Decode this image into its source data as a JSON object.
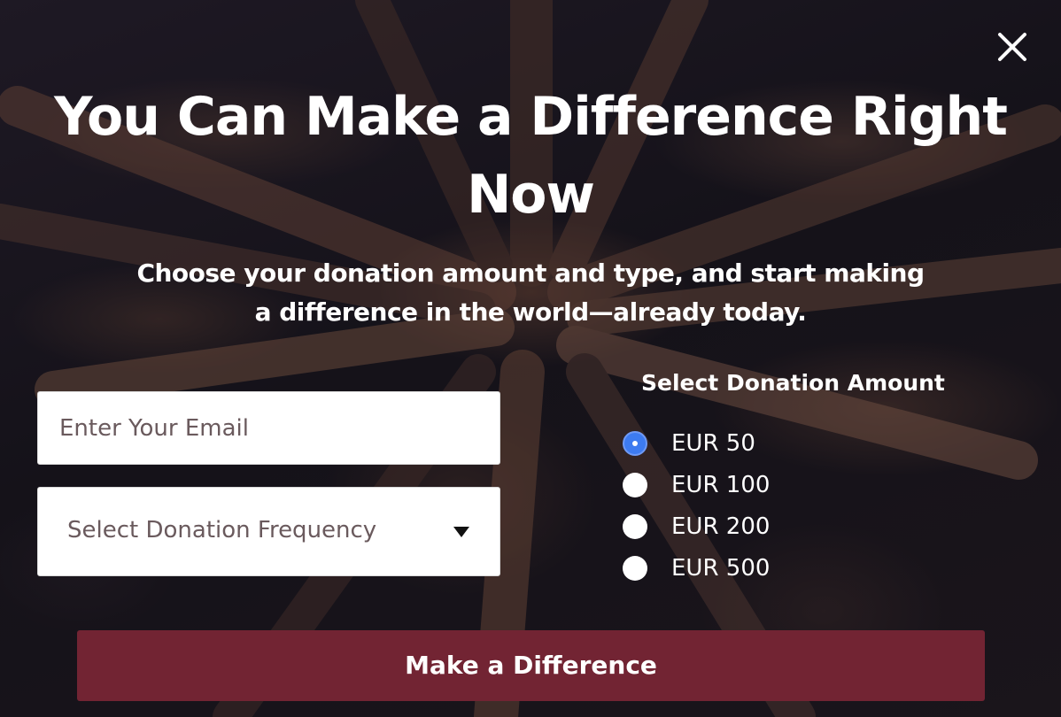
{
  "popup": {
    "close_icon": "close-icon",
    "headline": "You Can Make a Difference Right Now",
    "subhead": "Choose your donation amount and type, and start making a difference in the world—already today."
  },
  "form": {
    "email_placeholder": "Enter Your Email",
    "frequency_select": {
      "selected": "Select Donation Frequency",
      "icon": "caret-down-icon"
    },
    "amount": {
      "title": "Select Donation Amount",
      "options": [
        {
          "label": "EUR 50",
          "selected": true
        },
        {
          "label": "EUR 100",
          "selected": false
        },
        {
          "label": "EUR 200",
          "selected": false
        },
        {
          "label": "EUR 500",
          "selected": false
        }
      ]
    },
    "submit_label": "Make a Difference"
  },
  "colors": {
    "button": "#722433",
    "radio_selected": "#3d7bf0",
    "text": "#ffffff"
  }
}
